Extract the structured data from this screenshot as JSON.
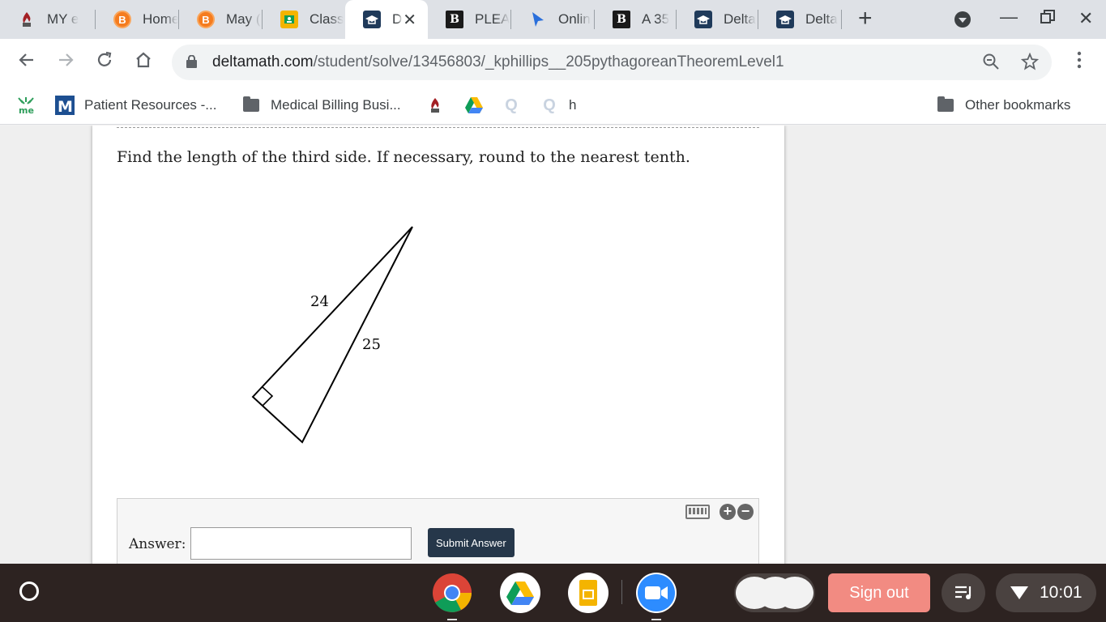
{
  "tabs": [
    {
      "title": "MY e",
      "favicon": "flame-icon"
    },
    {
      "title": "Home",
      "favicon": "bitmoji-icon"
    },
    {
      "title": "May (",
      "favicon": "bitmoji-icon"
    },
    {
      "title": "Class",
      "favicon": "classroom-icon"
    },
    {
      "title": "D",
      "favicon": "deltamath-icon",
      "active": true
    },
    {
      "title": "PLEA",
      "favicon": "b-icon"
    },
    {
      "title": "Onlin",
      "favicon": "cursor-icon"
    },
    {
      "title": "A 35",
      "favicon": "b-icon"
    },
    {
      "title": "Delta",
      "favicon": "deltamath-icon"
    },
    {
      "title": "Delta",
      "favicon": "deltamath-icon"
    }
  ],
  "url": {
    "host": "deltamath.com",
    "path": "/student/solve/13456803/_kphillips__205pythagoreanTheoremLevel1"
  },
  "bookmarks": {
    "patient": "Patient Resources -...",
    "medical": "Medical Billing Busi...",
    "h": "h",
    "other": "Other bookmarks"
  },
  "problem": {
    "question": "Find the length of the third side. If necessary, round to the nearest tenth.",
    "leg_label": "24",
    "hypotenuse_label": "25",
    "answer_label": "Answer:",
    "answer_value": "",
    "submit_label": "Submit Answer"
  },
  "shelf": {
    "signout_label": "Sign out",
    "time": "10:01"
  },
  "colors": {
    "submit_bg": "#26374a",
    "signout_bg": "#f28b82",
    "shelf_bg": "#2d2321"
  }
}
